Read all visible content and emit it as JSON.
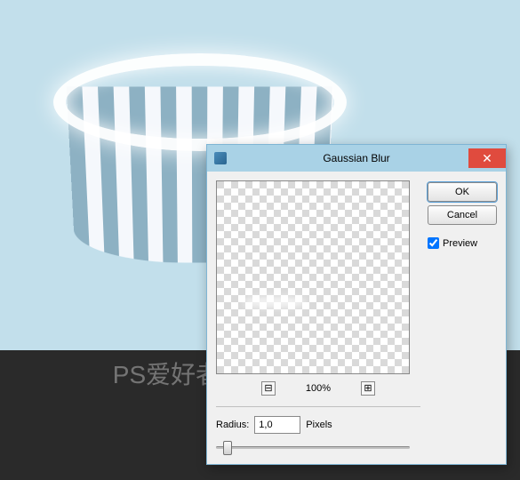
{
  "dialog": {
    "title": "Gaussian Blur",
    "ok_label": "OK",
    "cancel_label": "Cancel",
    "preview_label": "Preview",
    "zoom_level": "100%",
    "radius_label": "Radius:",
    "radius_value": "1,0",
    "radius_unit": "Pixels",
    "close_glyph": "✕",
    "zoom_out_glyph": "⊟",
    "zoom_in_glyph": "⊞"
  },
  "watermark": "PS爱好者  www.psahz.com"
}
